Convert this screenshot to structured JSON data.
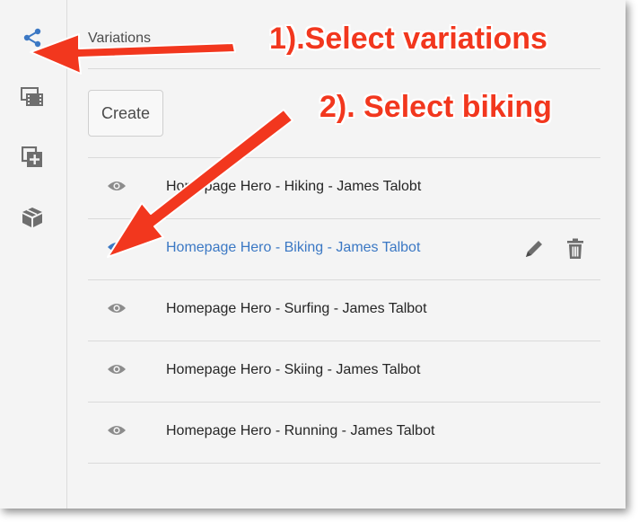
{
  "panel": {
    "title": "Variations"
  },
  "toolbar": {
    "create_label": "Create"
  },
  "sidebar": {
    "items": [
      {
        "icon": "share-icon",
        "active": true
      },
      {
        "icon": "assets-icon",
        "active": false
      },
      {
        "icon": "add-layer-icon",
        "active": false
      },
      {
        "icon": "package-icon",
        "active": false
      }
    ]
  },
  "variations": [
    {
      "label": "Homepage Hero - Hiking - James Talobt",
      "selected": false
    },
    {
      "label": "Homepage Hero - Biking - James Talbot",
      "selected": true
    },
    {
      "label": "Homepage Hero - Surfing - James Talbot",
      "selected": false
    },
    {
      "label": "Homepage Hero - Skiing - James Talbot",
      "selected": false
    },
    {
      "label": "Homepage Hero - Running - James Talbot",
      "selected": false
    }
  ],
  "annotations": {
    "step1": "1).Select variations",
    "step2": "2). Select biking"
  },
  "colors": {
    "accent": "#3b78c4",
    "annotation": "#f2371e",
    "icon_gray": "#6e6e6e",
    "eye_gray": "#8c8c8c"
  }
}
